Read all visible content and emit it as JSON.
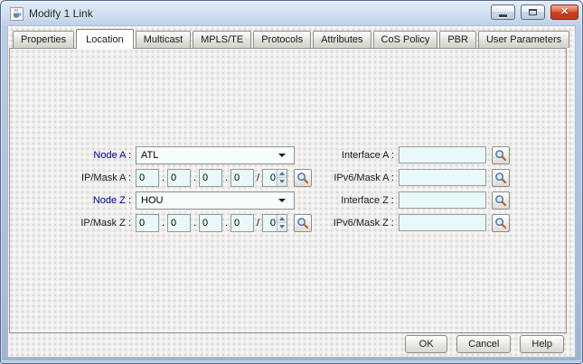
{
  "window": {
    "title": "Modify 1 Link",
    "app_icon": "java-coffee-cup-icon",
    "close_glyph": "✕"
  },
  "tabs": [
    {
      "label": "Properties"
    },
    {
      "label": "Location"
    },
    {
      "label": "Multicast"
    },
    {
      "label": "MPLS/TE"
    },
    {
      "label": "Protocols"
    },
    {
      "label": "Attributes"
    },
    {
      "label": "CoS Policy"
    },
    {
      "label": "PBR"
    },
    {
      "label": "User Parameters"
    }
  ],
  "active_tab": "Location",
  "form": {
    "node_a_label": "Node A :",
    "node_a_value": "ATL",
    "ip_mask_a_label": "IP/Mask A :",
    "ip_a_octets": [
      "0",
      "0",
      "0",
      "0"
    ],
    "ip_a_mask": "0",
    "node_z_label": "Node Z :",
    "node_z_value": "HOU",
    "ip_mask_z_label": "IP/Mask Z :",
    "ip_z_octets": [
      "0",
      "0",
      "0",
      "0"
    ],
    "ip_z_mask": "0",
    "dot": ".",
    "slash": "/",
    "interface_a_label": "Interface A :",
    "interface_a_value": "",
    "ipv6_mask_a_label": "IPv6/Mask A :",
    "ipv6_mask_a_value": "",
    "interface_z_label": "Interface Z :",
    "interface_z_value": "",
    "ipv6_mask_z_label": "IPv6/Mask Z :",
    "ipv6_mask_z_value": ""
  },
  "buttons": {
    "ok": "OK",
    "cancel": "Cancel",
    "help": "Help"
  },
  "icons": {
    "search": "magnifier-icon",
    "spinner_up": "triangle-up-icon",
    "spinner_down": "triangle-down-icon",
    "dropdown": "chevron-down-icon"
  },
  "colors": {
    "label_blue": "#0000a0",
    "field_bg": "#e9f8f8",
    "close_red": "#cd3f1e",
    "frame_blue": "#b2c8e3"
  }
}
